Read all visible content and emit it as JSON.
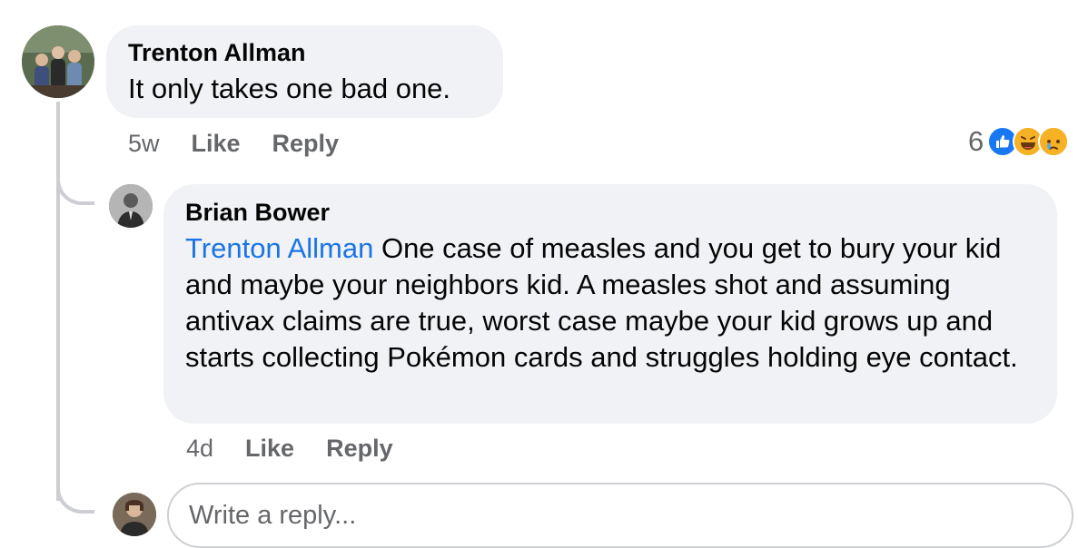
{
  "comments": [
    {
      "author": "Trenton Allman",
      "text": "It only takes one bad one.",
      "time": "5w",
      "like_label": "Like",
      "reply_label": "Reply",
      "reaction_count": "6",
      "reactions": [
        "like-icon",
        "haha-icon",
        "sad-icon"
      ],
      "avatar": "avatar-group-photo"
    }
  ],
  "reply": {
    "author": "Brian Bower",
    "mention": "Trenton Allman",
    "text": " One case of measles and you get to bury your kid and maybe your neighbors kid. A measles shot and assuming antivax claims are true, worst case maybe your kid grows up and starts collecting Pokémon cards and struggles holding eye contact.",
    "time": "4d",
    "like_label": "Like",
    "reply_label": "Reply",
    "avatar": "avatar-profile-photo"
  },
  "composer": {
    "placeholder": "Write a reply..."
  },
  "colors": {
    "bubble_bg": "#f0f2f5",
    "mention": "#1b74e4",
    "like_blue": "#1877f2",
    "meta_gray": "#65676b"
  }
}
